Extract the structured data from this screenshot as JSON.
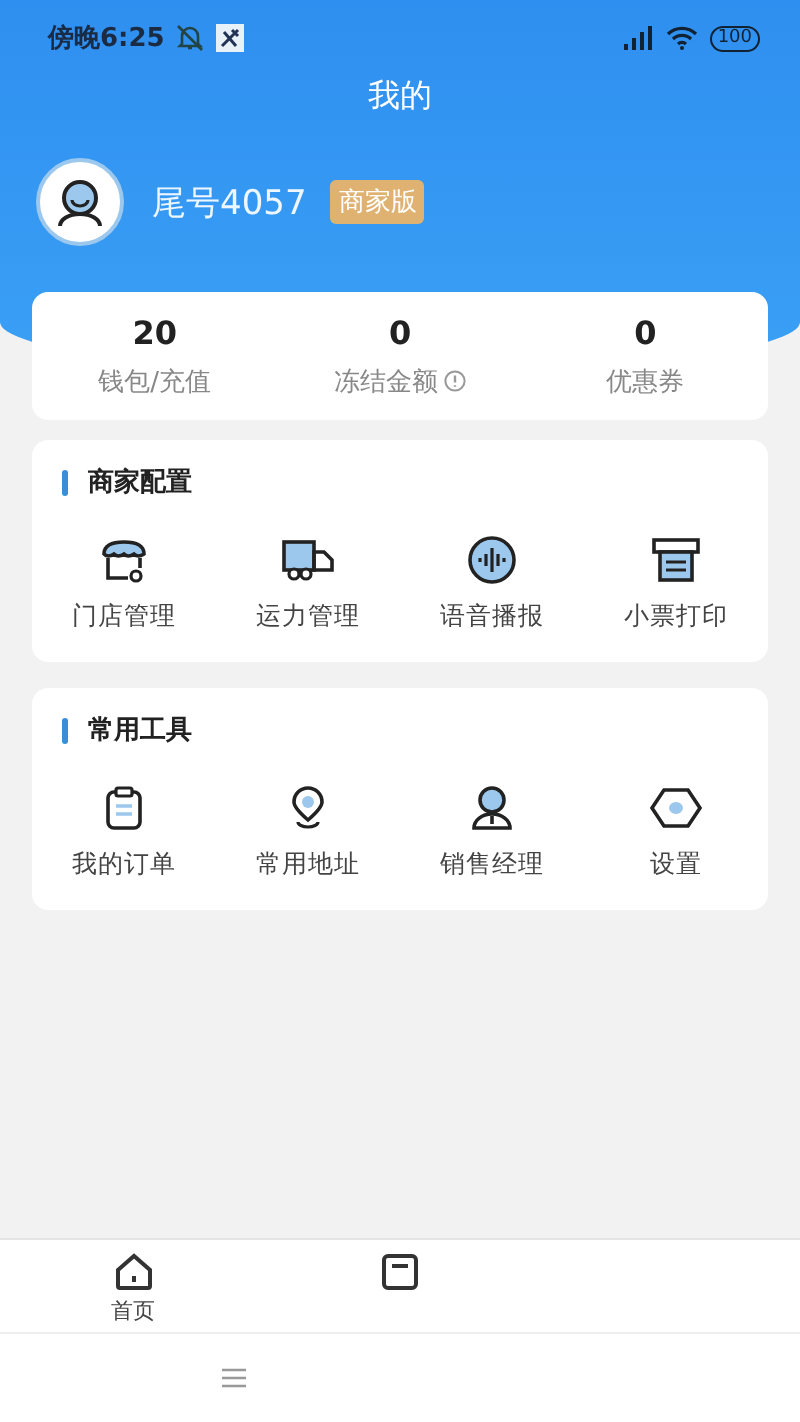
{
  "status_bar": {
    "time": "傍晚6:25",
    "battery": "100"
  },
  "title": "我的",
  "profile": {
    "name": "尾号4057",
    "badge": "商家版"
  },
  "stats": [
    {
      "value": "20",
      "label": "钱包/充值",
      "info": false
    },
    {
      "value": "0",
      "label": "冻结金额",
      "info": true
    },
    {
      "value": "0",
      "label": "优惠券",
      "info": false
    }
  ],
  "sections": [
    {
      "title": "商家配置",
      "items": [
        {
          "kind": "store",
          "label": "门店管理"
        },
        {
          "kind": "truck",
          "label": "运力管理"
        },
        {
          "kind": "voice",
          "label": "语音播报"
        },
        {
          "kind": "printer",
          "label": "小票打印"
        }
      ]
    },
    {
      "title": "常用工具",
      "items": [
        {
          "kind": "order",
          "label": "我的订单"
        },
        {
          "kind": "pin",
          "label": "常用地址"
        },
        {
          "kind": "manager",
          "label": "销售经理"
        },
        {
          "kind": "settings",
          "label": "设置"
        }
      ]
    }
  ],
  "tab_bar": [
    {
      "kind": "home",
      "label": "首页",
      "selected": false
    },
    {
      "kind": "orders",
      "selected": false
    }
  ]
}
